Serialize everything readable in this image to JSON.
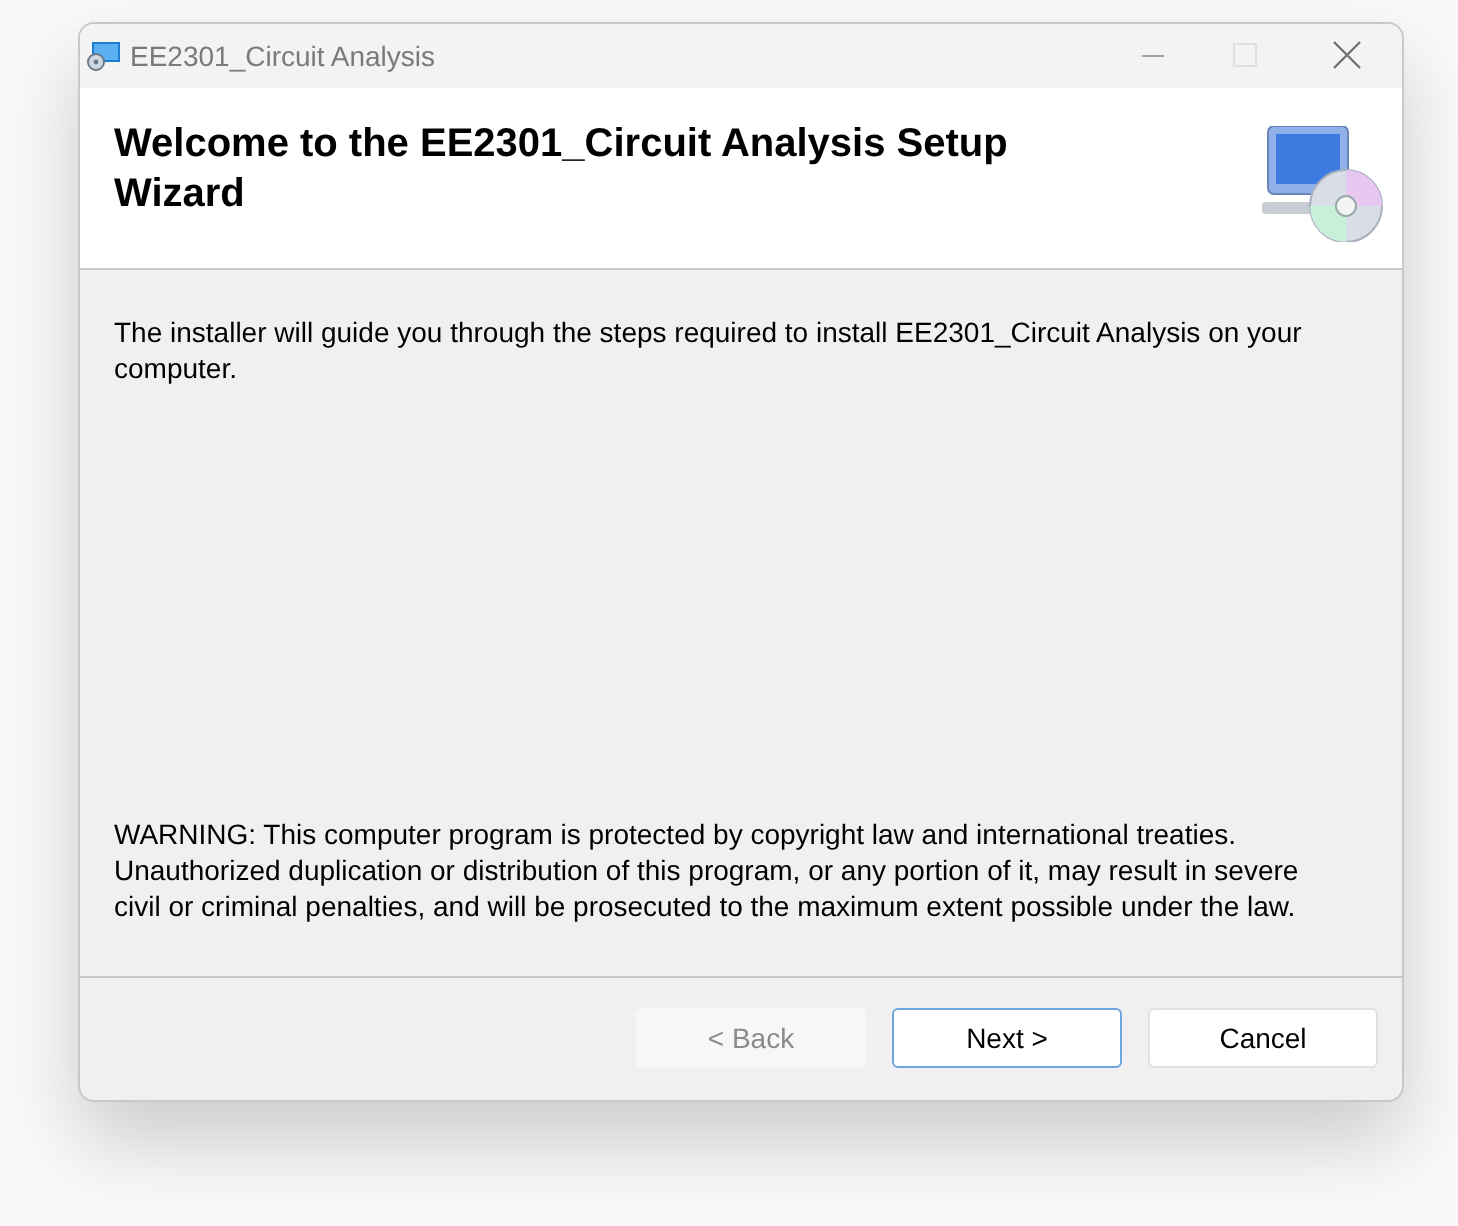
{
  "window": {
    "title": "EE2301_Circuit Analysis"
  },
  "header": {
    "title": "Welcome to the EE2301_Circuit Analysis Setup Wizard"
  },
  "intro": "The installer will guide you through the steps required to install EE2301_Circuit Analysis on your computer.",
  "warning": "WARNING: This computer program is protected by copyright law and international treaties. Unauthorized duplication or distribution of this program, or any portion of it, may result in severe civil or criminal penalties, and will be prosecuted to the maximum extent possible under the law.",
  "buttons": [
    {
      "label": "< Back",
      "disabled": true,
      "default": false
    },
    {
      "label": "Next >",
      "disabled": false,
      "default": true
    },
    {
      "label": "Cancel",
      "disabled": false,
      "default": false
    }
  ]
}
